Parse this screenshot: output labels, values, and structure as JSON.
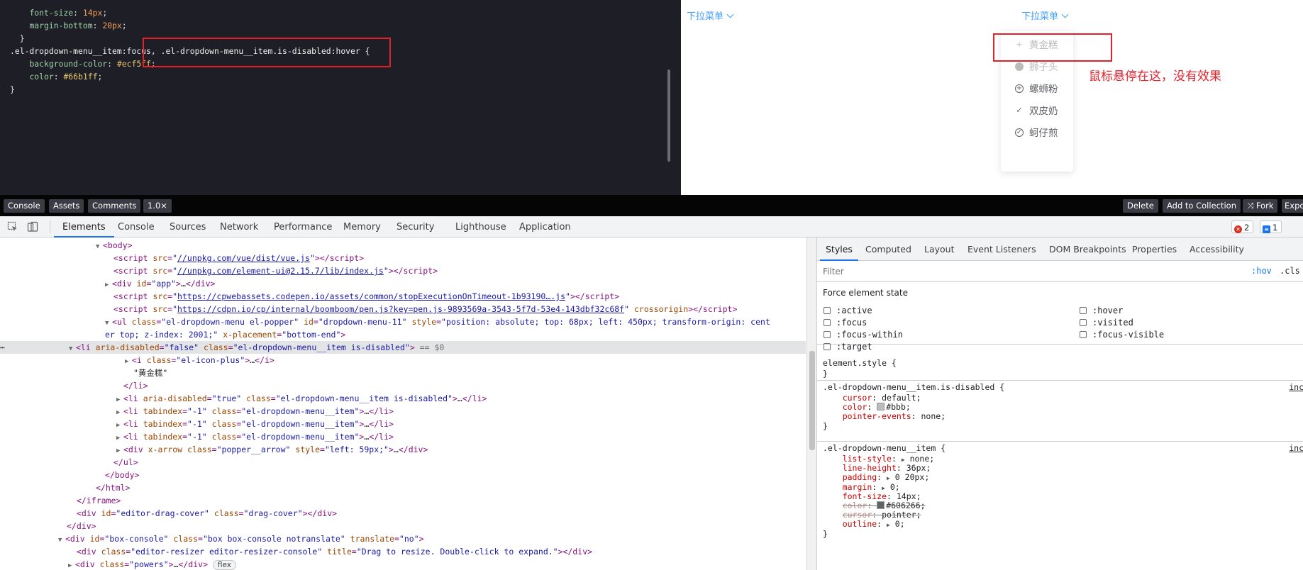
{
  "editor": {
    "lines": [
      {
        "indent": "    ",
        "prop": "font-size",
        "value": "14px",
        "vclass": "num"
      },
      {
        "indent": "    ",
        "prop": "margin-bottom",
        "value": "20px",
        "vclass": "num"
      },
      {
        "indent": "  ",
        "raw": "}"
      },
      {
        "indent": "",
        "selector": ".el-dropdown-menu__item:focus, .el-dropdown-menu__item.is-disabled:hover {"
      },
      {
        "indent": "    ",
        "prop": "background-color",
        "value": "#ecf5ff",
        "vclass": "hex"
      },
      {
        "indent": "    ",
        "prop": "color",
        "value": "#66b1ff",
        "vclass": "hex"
      },
      {
        "indent": "",
        "raw": "}"
      }
    ]
  },
  "preview": {
    "trigger_left": "下拉菜单",
    "trigger_right": "下拉菜单",
    "menu": [
      {
        "label": "黄金糕",
        "icon": "+",
        "icon_name": "plus-icon",
        "style": "plain",
        "disabled": true
      },
      {
        "label": "狮子头",
        "icon": "+",
        "icon_name": "circle-plus-filled-icon",
        "style": "filled",
        "disabled": true
      },
      {
        "label": "螺蛳粉",
        "icon": "+",
        "icon_name": "circle-plus-outline-icon",
        "style": "circle",
        "disabled": false
      },
      {
        "label": "双皮奶",
        "icon": "✓",
        "icon_name": "check-icon",
        "style": "plain",
        "disabled": false
      },
      {
        "label": "蚵仔煎",
        "icon": "✓",
        "icon_name": "circle-check-icon",
        "style": "circle",
        "disabled": false
      }
    ],
    "note": "鼠标悬停在这，没有效果"
  },
  "codepen": {
    "left_buttons": [
      "Console",
      "Assets",
      "Comments",
      "1.0×"
    ],
    "right_buttons": [
      "Delete",
      "Add to Collection",
      "⤨ Fork",
      "Expo"
    ]
  },
  "devtools": {
    "tabs": [
      "Elements",
      "Console",
      "Sources",
      "Network",
      "Performance",
      "Memory",
      "Security",
      "Lighthouse",
      "Application"
    ],
    "active_tab": "Elements",
    "errors": "2",
    "messages": "1"
  },
  "styles": {
    "tabs": [
      "Styles",
      "Computed",
      "Layout",
      "Event Listeners",
      "DOM Breakpoints",
      "Properties",
      "Accessibility"
    ],
    "filter_placeholder": "Filter",
    "hov": ":hov",
    "cls": ".cls",
    "force_title": "Force element state",
    "states_left": [
      ":active",
      ":focus",
      ":focus-within",
      ":target"
    ],
    "states_right": [
      ":hover",
      ":visited",
      ":focus-visible"
    ],
    "element_style": "element.style {",
    "rule1": {
      "selector": ".el-dropdown-menu__item.is-disabled {",
      "source": "inc",
      "props": [
        {
          "n": "cursor",
          "v": "default;"
        },
        {
          "n": "color",
          "v": "#bbb;",
          "swatch": "#bbbbbb"
        },
        {
          "n": "pointer-events",
          "v": "none;"
        }
      ]
    },
    "rule2": {
      "selector": ".el-dropdown-menu__item {",
      "source": "inc",
      "props": [
        {
          "n": "list-style",
          "v": "none;",
          "tri": true
        },
        {
          "n": "line-height",
          "v": "36px;"
        },
        {
          "n": "padding",
          "v": "0 20px;",
          "tri": true
        },
        {
          "n": "margin",
          "v": "0;",
          "tri": true
        },
        {
          "n": "font-size",
          "v": "14px;"
        },
        {
          "n": "color",
          "v": "#606266;",
          "swatch": "#606266",
          "strike": true
        },
        {
          "n": "cursor",
          "v": "pointer;",
          "strike": true
        },
        {
          "n": "outline",
          "v": "0;",
          "tri": true
        }
      ]
    },
    "closing_brace": "}"
  }
}
